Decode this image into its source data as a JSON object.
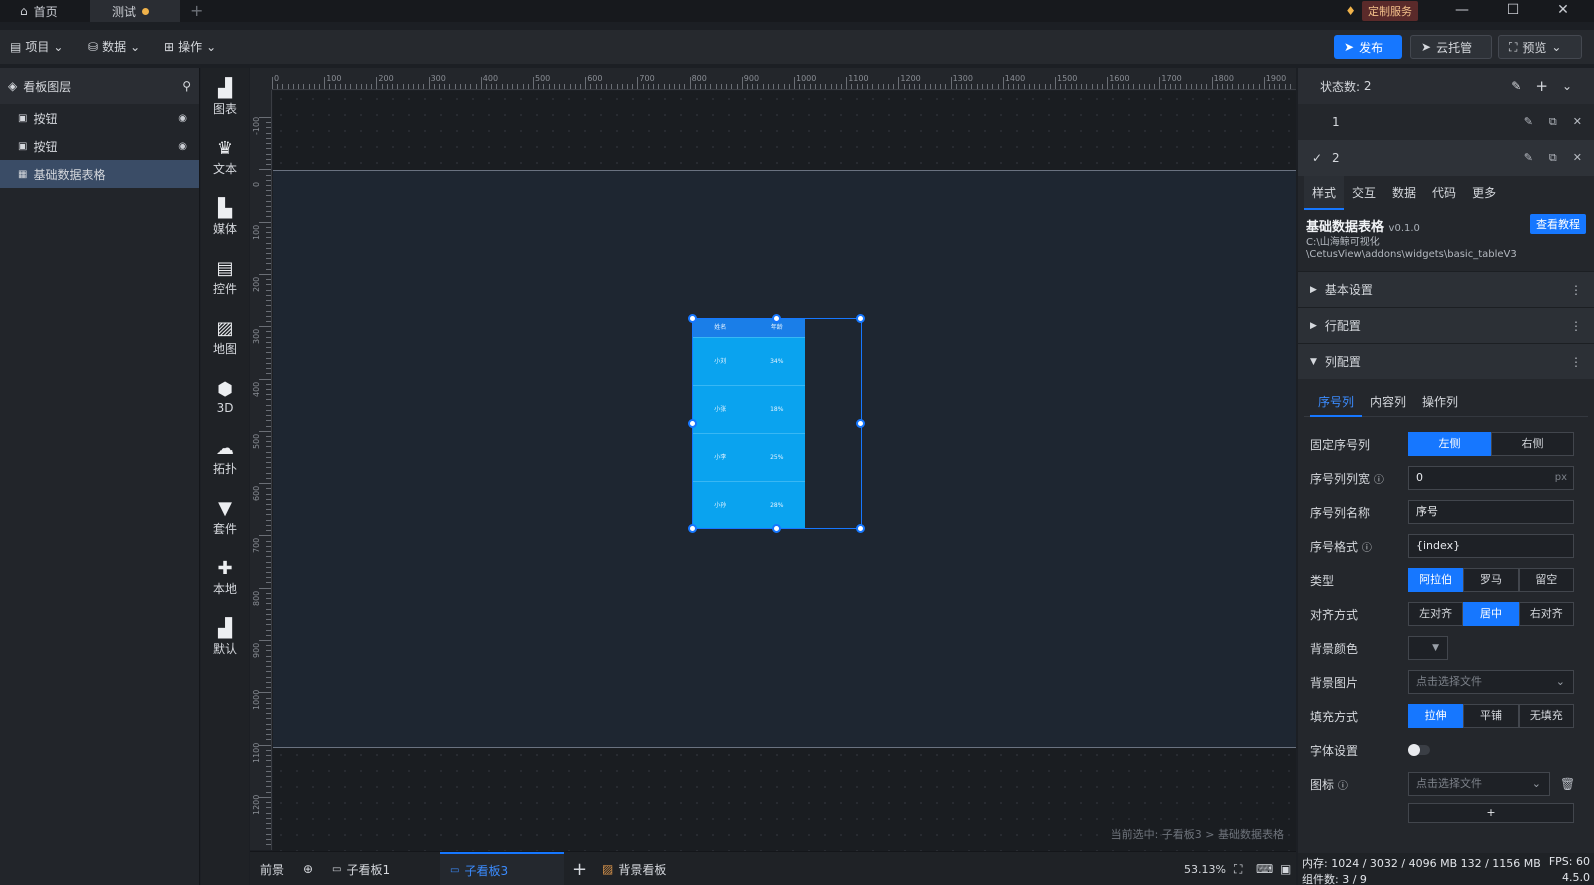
{
  "tabs": {
    "home": "首页",
    "test": "测试",
    "new": "+"
  },
  "service": "定制服务",
  "window": {
    "min": "—",
    "max": "☐",
    "close": "✕"
  },
  "menu": {
    "project": "项目",
    "data": "数据",
    "operate": "操作"
  },
  "top_buttons": {
    "publish": "发布",
    "cloud": "云托管",
    "preview": "预览"
  },
  "layers": {
    "title": "看板图层",
    "items": [
      {
        "label": "按钮"
      },
      {
        "label": "按钮"
      },
      {
        "label": "基础数据表格"
      }
    ]
  },
  "palette": [
    "图表",
    "文本",
    "媒体",
    "控件",
    "地图",
    "3D",
    "拓扑",
    "套件",
    "本地",
    "默认"
  ],
  "ruler": {
    "h_labels": [
      "0",
      "100",
      "200",
      "300",
      "400",
      "500",
      "600",
      "700",
      "800",
      "900",
      "1000",
      "1100",
      "1200",
      "1300",
      "1400",
      "1500",
      "1600",
      "1700",
      "1800",
      "1900"
    ],
    "v_labels": [
      "-100",
      "0",
      "100",
      "200",
      "300",
      "400",
      "500",
      "600",
      "700",
      "800",
      "900",
      "1000",
      "1100",
      "1200"
    ]
  },
  "widget_table": {
    "headers": [
      "姓名",
      "年龄"
    ],
    "rows": [
      [
        "小刘",
        "34%"
      ],
      [
        "小张",
        "18%"
      ],
      [
        "小李",
        "25%"
      ],
      [
        "小孙",
        "28%"
      ]
    ]
  },
  "canvas": {
    "selected_info": "当前选中: 子看板3 > 基础数据表格"
  },
  "bottom": {
    "foreground": "前景",
    "tabs": [
      "子看板1",
      "子看板3",
      "背景看板"
    ],
    "zoom": "53.13%"
  },
  "states": {
    "title": "状态数:",
    "count": "2",
    "rows": [
      "1",
      "2"
    ]
  },
  "panel_tabs": [
    "样式",
    "交互",
    "数据",
    "代码",
    "更多"
  ],
  "component": {
    "name": "基础数据表格",
    "version": "v0.1.0",
    "tutorial": "查看教程",
    "path1": "C:\\山海鲸可视化",
    "path2": "\\CetusView\\addons\\widgets\\basic_tableV3"
  },
  "sections": [
    "基本设置",
    "行配置",
    "列配置"
  ],
  "col_tabs": [
    "序号列",
    "内容列",
    "操作列"
  ],
  "form": {
    "fixed": {
      "label": "固定序号列",
      "options": [
        "左侧",
        "右侧"
      ],
      "selected": 0
    },
    "width": {
      "label": "序号列列宽",
      "value": "0",
      "unit": "px"
    },
    "name": {
      "label": "序号列名称",
      "value": "序号"
    },
    "format": {
      "label": "序号格式",
      "value": "{index}"
    },
    "type": {
      "label": "类型",
      "options": [
        "阿拉伯",
        "罗马",
        "留空"
      ],
      "selected": 0
    },
    "align": {
      "label": "对齐方式",
      "options": [
        "左对齐",
        "居中",
        "右对齐"
      ],
      "selected": 1
    },
    "bgcolor": {
      "label": "背景颜色"
    },
    "bgimage": {
      "label": "背景图片",
      "placeholder": "点击选择文件"
    },
    "fill": {
      "label": "填充方式",
      "options": [
        "拉伸",
        "平铺",
        "无填充"
      ],
      "selected": 0
    },
    "font": {
      "label": "字体设置",
      "on": false
    },
    "icon": {
      "label": "图标",
      "placeholder": "点击选择文件"
    },
    "add": "+"
  },
  "status_bar": {
    "memory": "内存: 1024 / 3032 / 4096 MB  132 / 1156 MB",
    "fps": "FPS: 60",
    "components": "组件数: 3 / 9",
    "version": "4.5.0"
  },
  "colors": {
    "accent": "#1677ff",
    "table": "#0aa3ef",
    "board": "#1e2631"
  }
}
